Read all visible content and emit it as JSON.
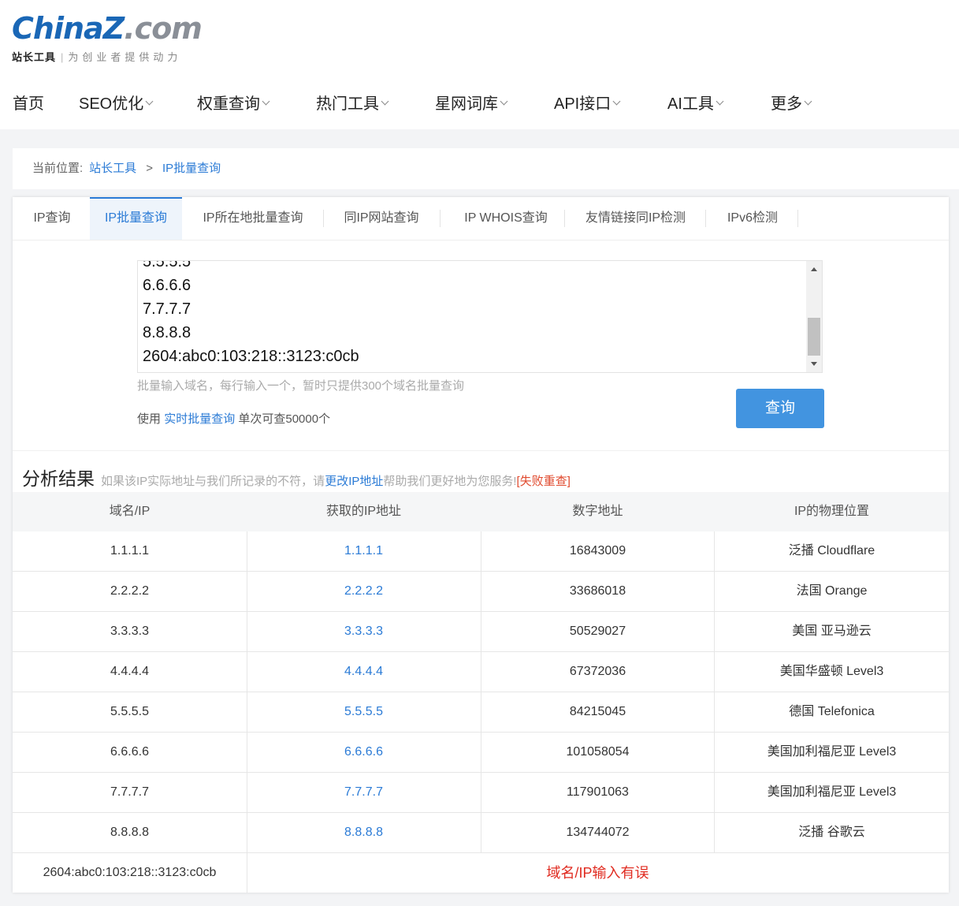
{
  "logo": {
    "china": "China",
    "z": "Z",
    "com": ".com",
    "sub_strong": "站长工具",
    "sub_bar": "|",
    "slogan": "为创业者提供动力"
  },
  "nav": [
    {
      "label": "首页"
    },
    {
      "label": "SEO优化"
    },
    {
      "label": "权重查询"
    },
    {
      "label": "热门工具"
    },
    {
      "label": "星网词库"
    },
    {
      "label": "API接口"
    },
    {
      "label": "AI工具"
    },
    {
      "label": "更多"
    }
  ],
  "breadcrumb": {
    "label": "当前位置:",
    "items": [
      "站长工具",
      "IP批量查询"
    ],
    "sep": ">"
  },
  "tabs": [
    {
      "label": "IP查询"
    },
    {
      "label": "IP批量查询",
      "active": true
    },
    {
      "label": "IP所在地批量查询"
    },
    {
      "label": "同IP网站查询"
    },
    {
      "label": "IP WHOIS查询"
    },
    {
      "label": "友情链接同IP检测"
    },
    {
      "label": "IPv6检测"
    }
  ],
  "textarea": {
    "lines": [
      "5.5.5.5",
      "6.6.6.6",
      "7.7.7.7",
      "8.8.8.8",
      "2604:abc0:103:218::3123:c0cb"
    ]
  },
  "hint": "批量输入域名，每行输入一个，暂时只提供300个域名批量查询",
  "usage": {
    "prefix": "使用",
    "link": "实时批量查询",
    "suffix": "单次可查50000个"
  },
  "query_button": "查询",
  "results": {
    "title": "分析结果",
    "note_prefix": "如果该IP实际地址与我们所记录的不符，请",
    "note_link": "更改IP地址",
    "note_mid": "帮助我们更好地为您服务!",
    "note_red": "[失败重查]",
    "headers": [
      "域名/IP",
      "获取的IP地址",
      "数字地址",
      "IP的物理位置"
    ],
    "rows": [
      {
        "domain": "1.1.1.1",
        "ip": "1.1.1.1",
        "num": "16843009",
        "loc": "泛播 Cloudflare"
      },
      {
        "domain": "2.2.2.2",
        "ip": "2.2.2.2",
        "num": "33686018",
        "loc": "法国 Orange"
      },
      {
        "domain": "3.3.3.3",
        "ip": "3.3.3.3",
        "num": "50529027",
        "loc": "美国 亚马逊云"
      },
      {
        "domain": "4.4.4.4",
        "ip": "4.4.4.4",
        "num": "67372036",
        "loc": "美国华盛顿 Level3"
      },
      {
        "domain": "5.5.5.5",
        "ip": "5.5.5.5",
        "num": "84215045",
        "loc": "德国 Telefonica"
      },
      {
        "domain": "6.6.6.6",
        "ip": "6.6.6.6",
        "num": "101058054",
        "loc": "美国加利福尼亚 Level3"
      },
      {
        "domain": "7.7.7.7",
        "ip": "7.7.7.7",
        "num": "117901063",
        "loc": "美国加利福尼亚 Level3"
      },
      {
        "domain": "8.8.8.8",
        "ip": "8.8.8.8",
        "num": "134744072",
        "loc": "泛播 谷歌云"
      }
    ],
    "error_row": {
      "domain": "2604:abc0:103:218::3123:c0cb",
      "message": "域名/IP输入有误"
    }
  },
  "colors": {
    "accent": "#2b7bd6",
    "button": "#4294e0",
    "error": "#e02b20",
    "logo_blue": "#1a67b6"
  }
}
